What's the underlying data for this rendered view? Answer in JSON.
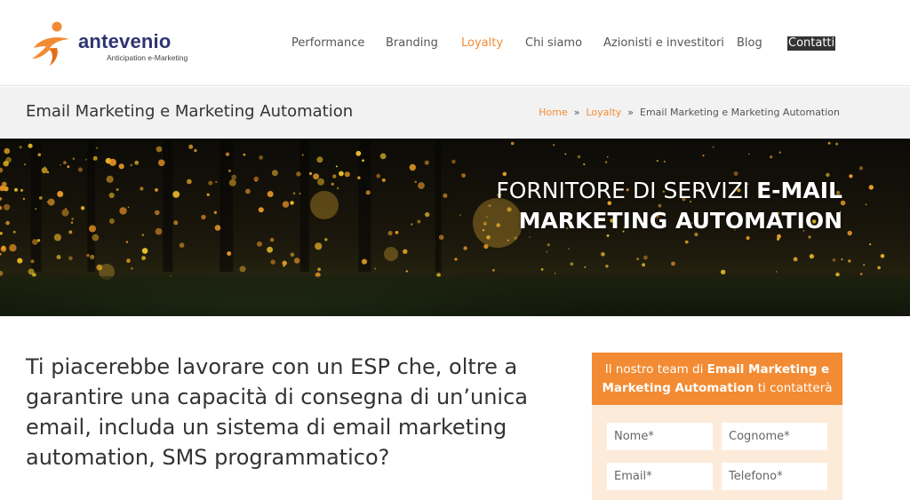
{
  "logo": {
    "name": "antevenio",
    "tagline": "Anticipation e-Marketing",
    "brand_orange": "#f28b33",
    "brand_navy": "#2e3472"
  },
  "nav": {
    "items": [
      {
        "label": "Performance",
        "state": "default"
      },
      {
        "label": "Branding",
        "state": "default"
      },
      {
        "label": "Loyalty",
        "state": "active"
      },
      {
        "label": "Chi siamo",
        "state": "default"
      },
      {
        "label": "Azionisti e investitori",
        "state": "default"
      },
      {
        "label": "Blog",
        "state": "default"
      },
      {
        "label": "Contatti",
        "state": "highlighted"
      }
    ]
  },
  "titlebar": {
    "title": "Email Marketing e Marketing Automation",
    "breadcrumb": {
      "home": "Home",
      "separator": "»",
      "section": "Loyalty",
      "current": "Email Marketing e Marketing Automation"
    }
  },
  "hero": {
    "line1_normal": "FORNITORE DI SERVIZI ",
    "line1_bold": "E-MAIL",
    "line2_bold": "MARKETING AUTOMATION"
  },
  "main": {
    "lead": "Ti piacerebbe lavorare con un ESP che, oltre a garantire una capacità di consegna di un’unica email, includa un sistema di email marketing automation, SMS programmatico?"
  },
  "form": {
    "head_pre": "Il nostro team di ",
    "head_bold": "Email Marketing e Marketing Automation",
    "head_post": " ti contatterà",
    "fields": {
      "nome": "Nome*",
      "cognome": "Cognome*",
      "email": "Email*",
      "telefono": "Telefono*"
    }
  }
}
